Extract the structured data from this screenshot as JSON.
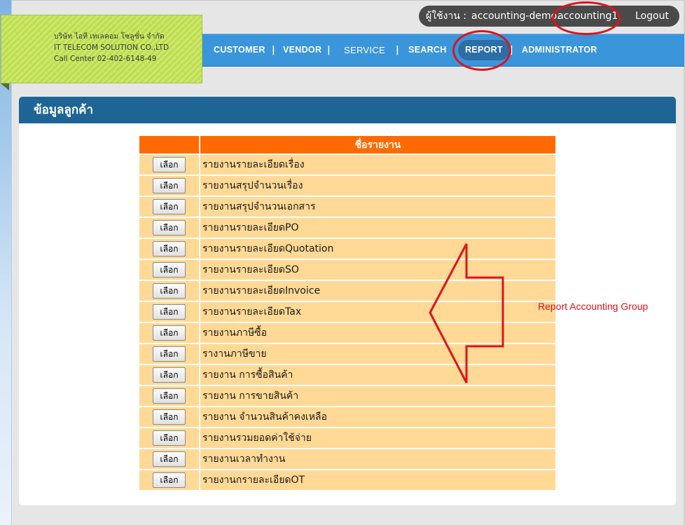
{
  "user_bar": {
    "label": "ผู้ใช้งาน :",
    "username": "accounting-demo.",
    "account": "accounting1",
    "logout": "Logout"
  },
  "company": {
    "name_th": "บริษัท ไอที เทเลคอม โซลูชั่น จำกัด",
    "name_en": "IT TELECOM SOLUTION CO.,LTD",
    "call_center": "Call Center 02-402-6148-49"
  },
  "nav": {
    "separator": "|",
    "items": [
      {
        "label": "CUSTOMER"
      },
      {
        "label": "VENDOR"
      },
      {
        "label": "SERVICE"
      },
      {
        "label": "SEARCH"
      },
      {
        "label": "REPORT",
        "active": true
      },
      {
        "label": "ADMINISTRATOR"
      }
    ]
  },
  "panel": {
    "title": "ข้อมูลลูกค้า"
  },
  "table": {
    "col_select": "",
    "col_name": "ชื่อรายงาน",
    "button_label": "เลือก",
    "rows": [
      "รายงานรายละเอียดเรื่อง",
      "รายงานสรุปจำนวนเรื่อง",
      "รายงานสรุปจำนวนเอกสาร",
      "รายงานรายละเอียดPO",
      "รายงานรายละเอียดQuotation",
      "รายงานรายละเอียดSO",
      "รายงานรายละเอียดInvoice",
      "รายงานรายละเอียดTax",
      "รายงานภาษีซื้อ",
      "รางานภาษีขาย",
      "รายงาน การซื้อสินค้า",
      "รายงาน การขายสินค้า",
      "รายงาน จำนวนสินค้าคงเหลือ",
      "รายงานรวมยอดค่าใช้จ่าย",
      "รายงานเวลาทำงาน",
      "รายงานกรายละเอียดOT"
    ]
  },
  "annotation": {
    "text": "Report Accounting Group",
    "color": "#e0121a"
  },
  "colors": {
    "nav_bg": "#3a95db",
    "panel_header": "#1e6596",
    "table_header": "#ff6a00",
    "table_row": "#ffd995",
    "logo_bg": "#cde86a"
  }
}
